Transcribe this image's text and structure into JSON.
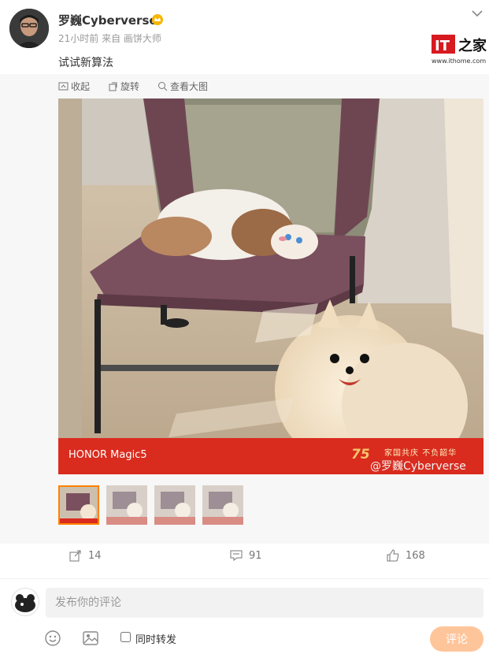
{
  "post": {
    "username": "罗巍Cyberverse",
    "meta": "21小时前 来自 画饼大师",
    "text": "试试新算法"
  },
  "site_logo": {
    "brand": "IT之家",
    "url": "www.ithome.com"
  },
  "media_toolbar": {
    "collect": "收起",
    "rotate": "旋转",
    "view_large": "查看大图"
  },
  "photo": {
    "brand_text": "HONOR Magic5",
    "anniversary": "75",
    "slogan": "家国共庆 不负韶华",
    "watermark": "@罗巍Cyberverse"
  },
  "actions": {
    "repost_count": "14",
    "comment_count": "91",
    "like_count": "168"
  },
  "comment_box": {
    "placeholder": "发布你的评论",
    "repost_label": "同时转发",
    "submit_label": "评论"
  },
  "colors": {
    "accent": "#ff8200",
    "banner": "#d92b1e",
    "submit_disabled": "#ffc59a"
  }
}
